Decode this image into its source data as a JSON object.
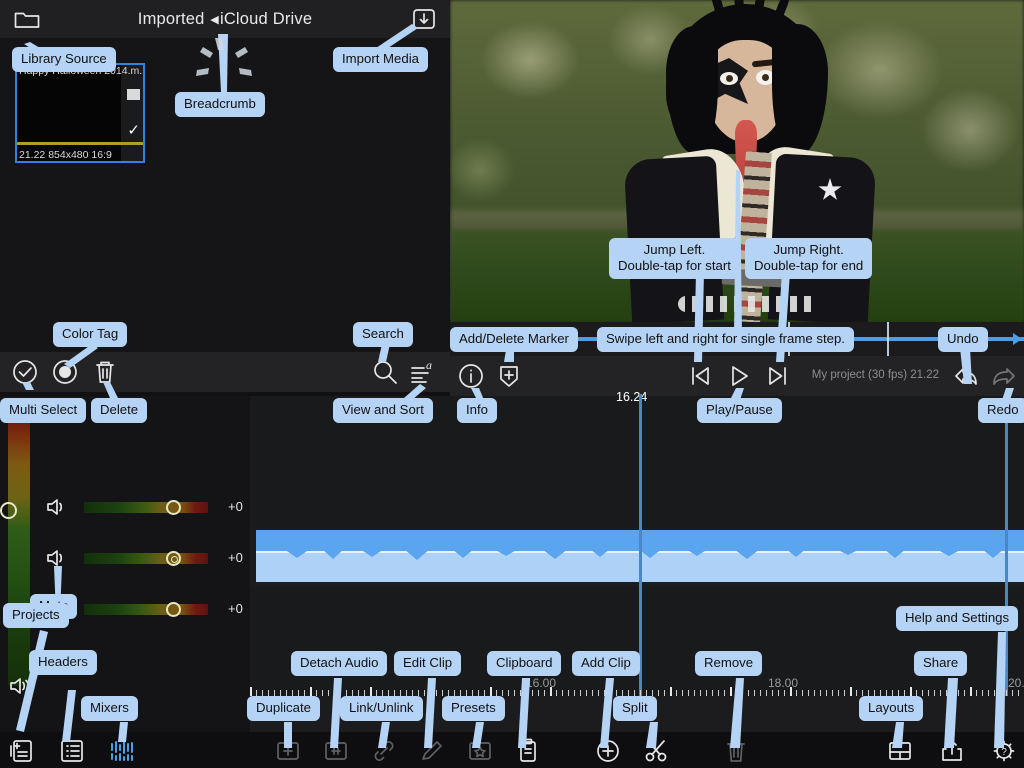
{
  "library": {
    "title_prefix": "Imported ",
    "crumb_sep": "◀",
    "title_suffix": "iCloud Drive",
    "folder_icon": "folder-icon",
    "import_icon": "import-media-icon",
    "media": {
      "name": "Happy Halloween 2014.m...",
      "meta": "21.22  854x480  16:9",
      "selected": true,
      "check_glyph": "✓"
    },
    "toolbar": [
      {
        "name": "multi-select",
        "icon": "check-circle-icon"
      },
      {
        "name": "color-tag",
        "icon": "color-tag-icon"
      },
      {
        "name": "delete",
        "icon": "trash-icon"
      },
      {
        "name": "search",
        "icon": "search-icon"
      },
      {
        "name": "view-and-sort",
        "icon": "sort-icon"
      }
    ]
  },
  "playback": {
    "info_icon": "info-icon",
    "marker_icon": "add-delete-marker-icon",
    "jump_left_icon": "jump-left-icon",
    "play_icon": "play-pause-icon",
    "jump_right_icon": "jump-right-icon",
    "undo_icon": "undo-icon",
    "redo_icon": "redo-icon",
    "project_status": "My project (30 fps)  21.22",
    "playhead_time": "16.24"
  },
  "mixer": {
    "rows": [
      {
        "mute_icon": "speaker-icon",
        "value": "+0"
      },
      {
        "mute_icon": "speaker-icon",
        "value": "+0"
      },
      {
        "mute_icon": "",
        "value": "+0"
      }
    ],
    "master_mute_icon": "speaker-mute-icon"
  },
  "timeline": {
    "ruler_labels": [
      "16.00",
      "18.00",
      "20."
    ],
    "clip_type": "audio-waveform"
  },
  "bottom_toolbar": {
    "left": [
      {
        "name": "projects",
        "icon": "add-project-icon",
        "active": false
      },
      {
        "name": "headers",
        "icon": "headers-icon",
        "active": false
      },
      {
        "name": "mixers",
        "icon": "mixers-icon",
        "active": true
      }
    ],
    "center": [
      {
        "name": "duplicate",
        "icon": "duplicate-icon",
        "dim": true
      },
      {
        "name": "detach-audio",
        "icon": "detach-audio-icon",
        "dim": true
      },
      {
        "name": "link-unlink",
        "icon": "link-icon",
        "dim": true
      },
      {
        "name": "edit-clip",
        "icon": "pencil-icon",
        "dim": true
      },
      {
        "name": "presets",
        "icon": "presets-icon",
        "dim": true
      },
      {
        "name": "clipboard",
        "icon": "clipboard-icon",
        "dim": false
      },
      {
        "name": "add-clip",
        "icon": "plus-circle-icon",
        "dim": false
      },
      {
        "name": "split",
        "icon": "scissors-icon",
        "dim": false
      },
      {
        "name": "remove",
        "icon": "trash-icon",
        "dim": true
      }
    ],
    "right": [
      {
        "name": "layouts",
        "icon": "layouts-icon",
        "dim": false
      },
      {
        "name": "share",
        "icon": "share-icon",
        "dim": false
      },
      {
        "name": "help-and-settings",
        "icon": "help-settings-icon",
        "dim": false
      }
    ]
  },
  "callouts": {
    "library_source": "Library Source",
    "breadcrumb": "Breadcrumb",
    "import_media": "Import Media",
    "color_tag": "Color Tag",
    "search": "Search",
    "multi_select": "Multi Select",
    "delete": "Delete",
    "view_and_sort": "View and Sort",
    "swipe_frame_step": "Swipe left and right for single frame step.",
    "jump_left": "Jump Left.\nDouble-tap for start",
    "jump_right": "Jump Right.\nDouble-tap for end",
    "add_delete_marker": "Add/Delete Marker",
    "undo": "Undo",
    "redo": "Redo",
    "info": "Info",
    "play_pause": "Play/Pause",
    "mute": "Mute",
    "projects": "Projects",
    "headers": "Headers",
    "mixers": "Mixers",
    "duplicate": "Duplicate",
    "detach_audio": "Detach Audio",
    "link_unlink": "Link/Unlink",
    "edit_clip": "Edit Clip",
    "presets": "Presets",
    "clipboard": "Clipboard",
    "add_clip": "Add Clip",
    "split": "Split",
    "remove": "Remove",
    "layouts": "Layouts",
    "share": "Share",
    "help_and_settings": "Help and Settings"
  },
  "colors": {
    "callout_bg": "#b5d3f5",
    "accent_blue": "#4a9eea",
    "clip_blue": "#5ba4ef",
    "selection_blue": "#2f84e0"
  }
}
